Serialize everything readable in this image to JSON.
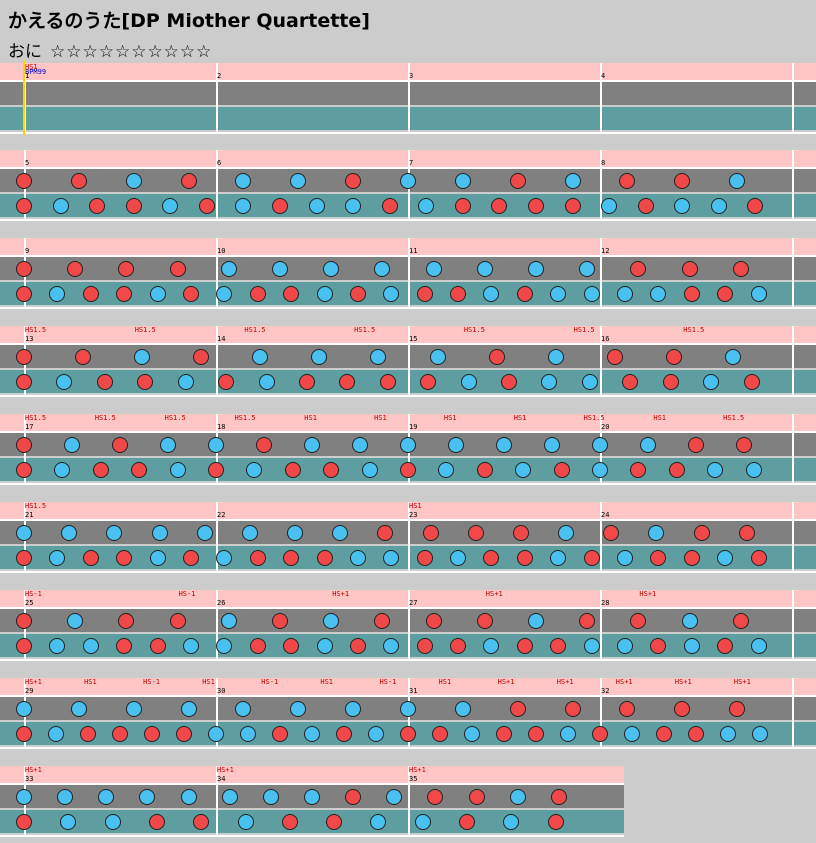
{
  "title": "かえるのうた[DP Miother Quartette]",
  "difficulty": "おに",
  "stars": "☆☆☆☆☆☆☆☆☆☆",
  "colors": {
    "background": "#cccccc",
    "pink_band": "#ffc6c6",
    "grey_lane": "#808080",
    "teal_lane": "#5f9ea0",
    "don": "#f04848",
    "ka": "#48c0f0",
    "command": "#c00000",
    "bpm": "#0000c0"
  },
  "bpm_label": "BPM99",
  "rows": [
    {
      "bars": [
        "1",
        "2",
        "3",
        "4"
      ],
      "commands": [
        "HS1"
      ],
      "top": [],
      "bottom": []
    },
    {
      "bars": [
        "5",
        "6",
        "7",
        "8"
      ],
      "commands": [],
      "top": [
        "d",
        "d",
        "k",
        "d",
        "k",
        "k",
        "d",
        "k",
        "k",
        "d",
        "k",
        "d",
        "d",
        "k"
      ],
      "bottom": [
        "d",
        "k",
        "d",
        "d",
        "k",
        "d",
        "k",
        "d",
        "k",
        "k",
        "d",
        "k",
        "d",
        "d",
        "d",
        "d",
        "k",
        "d",
        "k",
        "k",
        "d"
      ]
    },
    {
      "bars": [
        "9",
        "10",
        "11",
        "12"
      ],
      "commands": [],
      "top": [
        "d",
        "d",
        "d",
        "d",
        "k",
        "k",
        "k",
        "k",
        "k",
        "k",
        "k",
        "k",
        "d",
        "d",
        "d"
      ],
      "bottom": [
        "d",
        "k",
        "d",
        "d",
        "k",
        "d",
        "k",
        "d",
        "d",
        "k",
        "d",
        "k",
        "d",
        "d",
        "k",
        "d",
        "k",
        "k",
        "k",
        "k",
        "d",
        "d",
        "k"
      ]
    },
    {
      "bars": [
        "13",
        "14",
        "15",
        "16"
      ],
      "commands": [
        "HS1.5",
        "HS1.5",
        "HS1.5",
        "HS1.5",
        "HS1.5",
        "HS1.5",
        "HS1.5"
      ],
      "top": [
        "d",
        "d",
        "k",
        "d",
        "k",
        "k",
        "k",
        "k",
        "d",
        "k",
        "d",
        "d",
        "k"
      ],
      "bottom": [
        "d",
        "k",
        "d",
        "d",
        "k",
        "d",
        "k",
        "d",
        "d",
        "d",
        "d",
        "k",
        "d",
        "k",
        "k",
        "d",
        "d",
        "k",
        "d"
      ]
    },
    {
      "bars": [
        "17",
        "18",
        "19",
        "20"
      ],
      "commands": [
        "HS1.5",
        "HS1.5",
        "HS1.5",
        "HS1.5",
        "HS1",
        "HS1",
        "HS1",
        "HS1",
        "HS1.5",
        "HS1",
        "HS1.5"
      ],
      "top": [
        "d",
        "k",
        "d",
        "k",
        "k",
        "d",
        "k",
        "k",
        "k",
        "k",
        "k",
        "k",
        "k",
        "k",
        "d",
        "d"
      ],
      "bottom": [
        "d",
        "k",
        "d",
        "d",
        "k",
        "d",
        "k",
        "d",
        "d",
        "k",
        "d",
        "k",
        "d",
        "k",
        "d",
        "k",
        "d",
        "d",
        "k",
        "k"
      ]
    },
    {
      "bars": [
        "21",
        "22",
        "23",
        "24"
      ],
      "commands": [
        "HS1.5",
        "HS1"
      ],
      "top": [
        "k",
        "k",
        "k",
        "k",
        "k",
        "k",
        "k",
        "k",
        "d",
        "d",
        "d",
        "d",
        "k",
        "d",
        "k",
        "d",
        "d"
      ],
      "bottom": [
        "d",
        "k",
        "d",
        "d",
        "k",
        "d",
        "k",
        "d",
        "d",
        "d",
        "k",
        "k",
        "d",
        "k",
        "d",
        "d",
        "k",
        "d",
        "k",
        "d",
        "d",
        "k",
        "d"
      ]
    },
    {
      "bars": [
        "25",
        "26",
        "27",
        "28"
      ],
      "commands": [
        "HS-1",
        "HS-1",
        "HS+1",
        "HS+1",
        "HS+1"
      ],
      "top": [
        "d",
        "k",
        "d",
        "d",
        "k",
        "d",
        "k",
        "d",
        "d",
        "d",
        "k",
        "d",
        "d",
        "k",
        "d"
      ],
      "bottom": [
        "d",
        "k",
        "k",
        "d",
        "d",
        "k",
        "k",
        "d",
        "d",
        "k",
        "d",
        "k",
        "d",
        "d",
        "k",
        "d",
        "d",
        "k",
        "k",
        "d",
        "k",
        "d",
        "k"
      ]
    },
    {
      "bars": [
        "29",
        "30",
        "31",
        "32"
      ],
      "commands": [
        "HS+1",
        "HS1",
        "HS-1",
        "HS1",
        "HS-1",
        "HS1",
        "HS-1",
        "HS1",
        "HS+1",
        "HS+1",
        "HS+1",
        "HS+1",
        "HS+1"
      ],
      "top": [
        "k",
        "k",
        "k",
        "k",
        "k",
        "k",
        "k",
        "k",
        "k",
        "d",
        "d",
        "d",
        "d",
        "d"
      ],
      "bottom": [
        "d",
        "k",
        "d",
        "d",
        "d",
        "d",
        "k",
        "k",
        "d",
        "k",
        "d",
        "k",
        "d",
        "d",
        "k",
        "d",
        "d",
        "k",
        "d",
        "k",
        "d",
        "d",
        "k",
        "k"
      ]
    },
    {
      "bars": [
        "33",
        "34",
        "35"
      ],
      "commands": [
        "HS+1",
        "HS+1",
        "HS+1"
      ],
      "top": [
        "k",
        "k",
        "k",
        "k",
        "k",
        "k",
        "k",
        "k",
        "d",
        "k",
        "d",
        "d",
        "k",
        "d"
      ],
      "bottom": [
        "d",
        "k",
        "k",
        "d",
        "d",
        "k",
        "d",
        "d",
        "k",
        "k",
        "d",
        "k",
        "d"
      ]
    }
  ]
}
